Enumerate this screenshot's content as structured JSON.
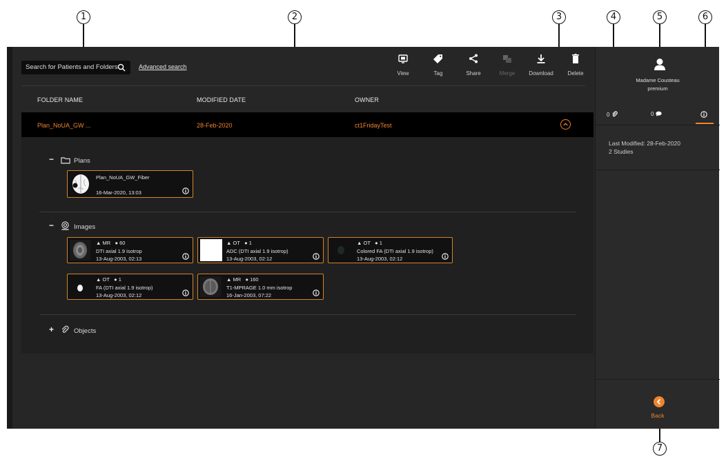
{
  "callouts": [
    "1",
    "2",
    "3",
    "4",
    "5",
    "6",
    "7"
  ],
  "toolbar": {
    "search_placeholder": "Search for Patients and Folders",
    "advanced_search": "Advanced search",
    "tools": [
      {
        "label": "View",
        "icon": "view-icon",
        "disabled": false
      },
      {
        "label": "Tag",
        "icon": "tag-icon",
        "disabled": false
      },
      {
        "label": "Share",
        "icon": "share-icon",
        "disabled": false
      },
      {
        "label": "Merge",
        "icon": "merge-icon",
        "disabled": true
      },
      {
        "label": "Download",
        "icon": "download-icon",
        "disabled": false
      },
      {
        "label": "Delete",
        "icon": "trash-icon",
        "disabled": false
      }
    ]
  },
  "table": {
    "columns": [
      "FOLDER NAME",
      "MODIFIED DATE",
      "OWNER"
    ],
    "row": {
      "folder_name": "Plan_NoUA_GW ...",
      "modified_date": "28-Feb-2020",
      "owner": "ct1FridayTest"
    }
  },
  "sections": {
    "plans": {
      "toggle": "−",
      "label": "Plans",
      "items": [
        {
          "name": "Plan_NoUA_GW_Fiber",
          "date": "16-Mar-2020, 13:03"
        }
      ]
    },
    "images": {
      "toggle": "−",
      "label": "Images",
      "items": [
        {
          "modality": "MR",
          "count": "60",
          "desc": "DTI axial 1.9 isotrop",
          "date": "13-Aug-2003, 02:13",
          "thumb": "brain-mri"
        },
        {
          "modality": "OT",
          "count": "1",
          "desc": "ADC (DTI axial 1.9 isotrop)",
          "date": "13-Aug-2003, 02:12",
          "thumb": "white"
        },
        {
          "modality": "OT",
          "count": "1",
          "desc": "Colored FA (DTI axial 1.9 isotrop)",
          "date": "13-Aug-2003, 02:12",
          "thumb": "dark"
        },
        {
          "modality": "OT",
          "count": "1",
          "desc": "FA (DTI axial 1.9 isotrop)",
          "date": "13-Aug-2003, 02:12",
          "thumb": "white-blob"
        },
        {
          "modality": "MR",
          "count": "160",
          "desc": "T1-MPRAGE 1.0 mm isotrop",
          "date": "16-Jan-2003, 07:22",
          "thumb": "brain-mri-2"
        }
      ]
    },
    "objects": {
      "toggle": "+",
      "label": "Objects"
    }
  },
  "right_panel": {
    "user_line1": "Madame Cousteau",
    "user_line2": "premium",
    "tabs": [
      {
        "count": "0",
        "icon": "paperclip-icon"
      },
      {
        "count": "0",
        "icon": "comment-icon"
      },
      {
        "count": "",
        "icon": "info-icon",
        "active": true
      }
    ],
    "info_line1": "Last Modified: 28-Feb-2020",
    "info_line2": "2 Studies",
    "back_label": "Back"
  },
  "colors": {
    "accent": "#f0852c",
    "background": "#262626",
    "row_selected": "#000000"
  }
}
